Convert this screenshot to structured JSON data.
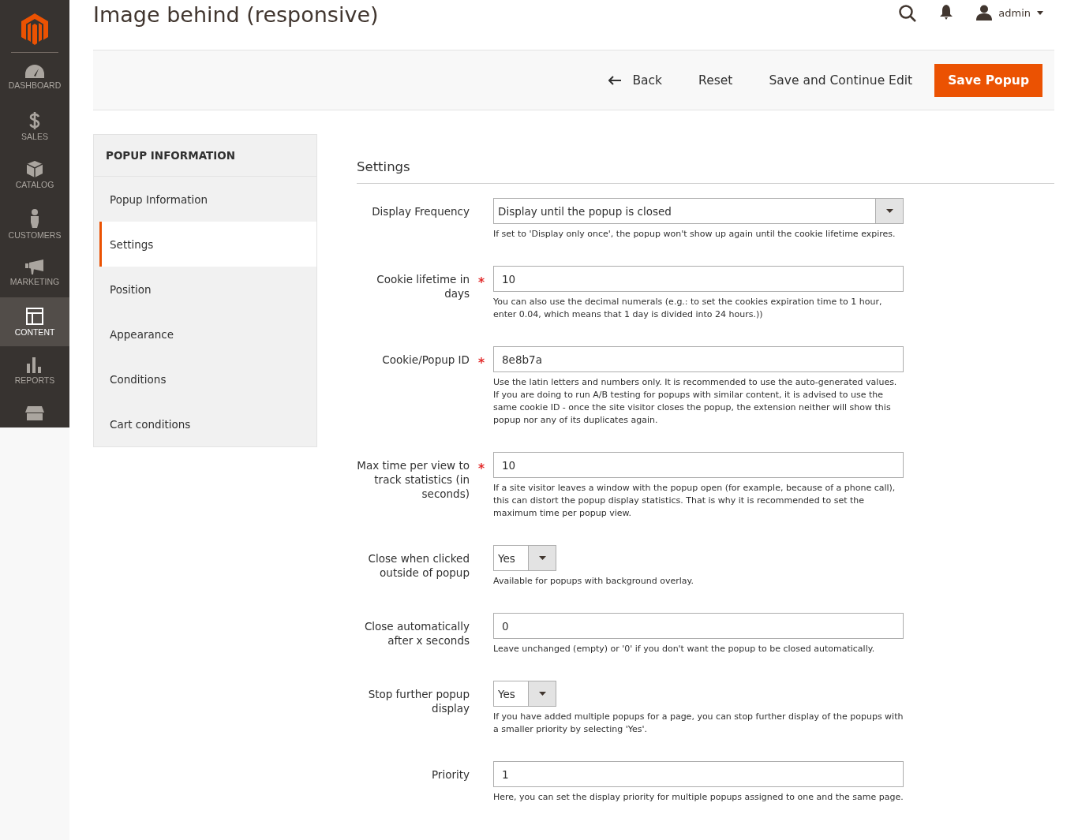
{
  "page_title": "Image behind (responsive)",
  "header": {
    "user": "admin"
  },
  "sidebar": {
    "items": [
      {
        "label": "DASHBOARD",
        "selected": false
      },
      {
        "label": "SALES",
        "selected": false
      },
      {
        "label": "CATALOG",
        "selected": false
      },
      {
        "label": "CUSTOMERS",
        "selected": false
      },
      {
        "label": "MARKETING",
        "selected": false
      },
      {
        "label": "CONTENT",
        "selected": true
      },
      {
        "label": "REPORTS",
        "selected": false
      }
    ]
  },
  "actions": [
    {
      "label": "Back",
      "kind": "back"
    },
    {
      "label": "Reset",
      "kind": "plain"
    },
    {
      "label": "Save and Continue Edit",
      "kind": "plain"
    },
    {
      "label": "Save Popup",
      "kind": "primary"
    }
  ],
  "tabs_panel": {
    "title": "POPUP INFORMATION",
    "items": [
      {
        "label": "Popup Information",
        "selected": false
      },
      {
        "label": "Settings",
        "selected": true
      },
      {
        "label": "Position",
        "selected": false
      },
      {
        "label": "Appearance",
        "selected": false
      },
      {
        "label": "Conditions",
        "selected": false
      },
      {
        "label": "Cart conditions",
        "selected": false
      }
    ]
  },
  "section_title": "Settings",
  "fields": [
    {
      "label": "Display Frequency",
      "kind": "select",
      "required": false,
      "value": "Display until the popup is closed",
      "note": "If set to 'Display only once', the popup won't show up again until the cookie lifetime expires."
    },
    {
      "label": "Cookie lifetime in days",
      "kind": "text",
      "required": true,
      "value": "10",
      "note": "You can also use the decimal numerals (e.g.: to set the cookies expiration time to 1 hour, enter 0.04, which means that 1 day is divided into 24 hours.))"
    },
    {
      "label": "Cookie/Popup ID",
      "kind": "text",
      "required": true,
      "value": "8e8b7a",
      "note": "Use the latin letters and numbers only. It is recommended to use the auto-generated values. If you are doing to run A/B testing for popups with similar content, it is advised to use the same cookie ID - once the site visitor closes the popup, the extension neither will show this popup nor any of its duplicates again."
    },
    {
      "label": "Max time per view to track statistics (in seconds)",
      "kind": "text",
      "required": true,
      "value": "10",
      "note": "If a site visitor leaves a window with the popup open (for example, because of a phone call), this can distort the popup display statistics. That is why it is recommended to set the maximum time per popup view."
    },
    {
      "label": "Close when clicked outside of popup",
      "kind": "small-select",
      "required": false,
      "value": "Yes",
      "note": "Available for popups with background overlay."
    },
    {
      "label": "Close automatically after x seconds",
      "kind": "text",
      "required": false,
      "value": "0",
      "note": "Leave unchanged (empty) or '0' if you don't want the popup to be closed automatically."
    },
    {
      "label": "Stop further popup display",
      "kind": "small-select",
      "required": false,
      "value": "Yes",
      "note": "If you have added multiple popups for a page, you can stop further display of the popups with a smaller priority by selecting 'Yes'."
    },
    {
      "label": "Priority",
      "kind": "text",
      "required": false,
      "value": "1",
      "note": "Here, you can set the display priority for multiple popups assigned to one and the same page."
    }
  ]
}
